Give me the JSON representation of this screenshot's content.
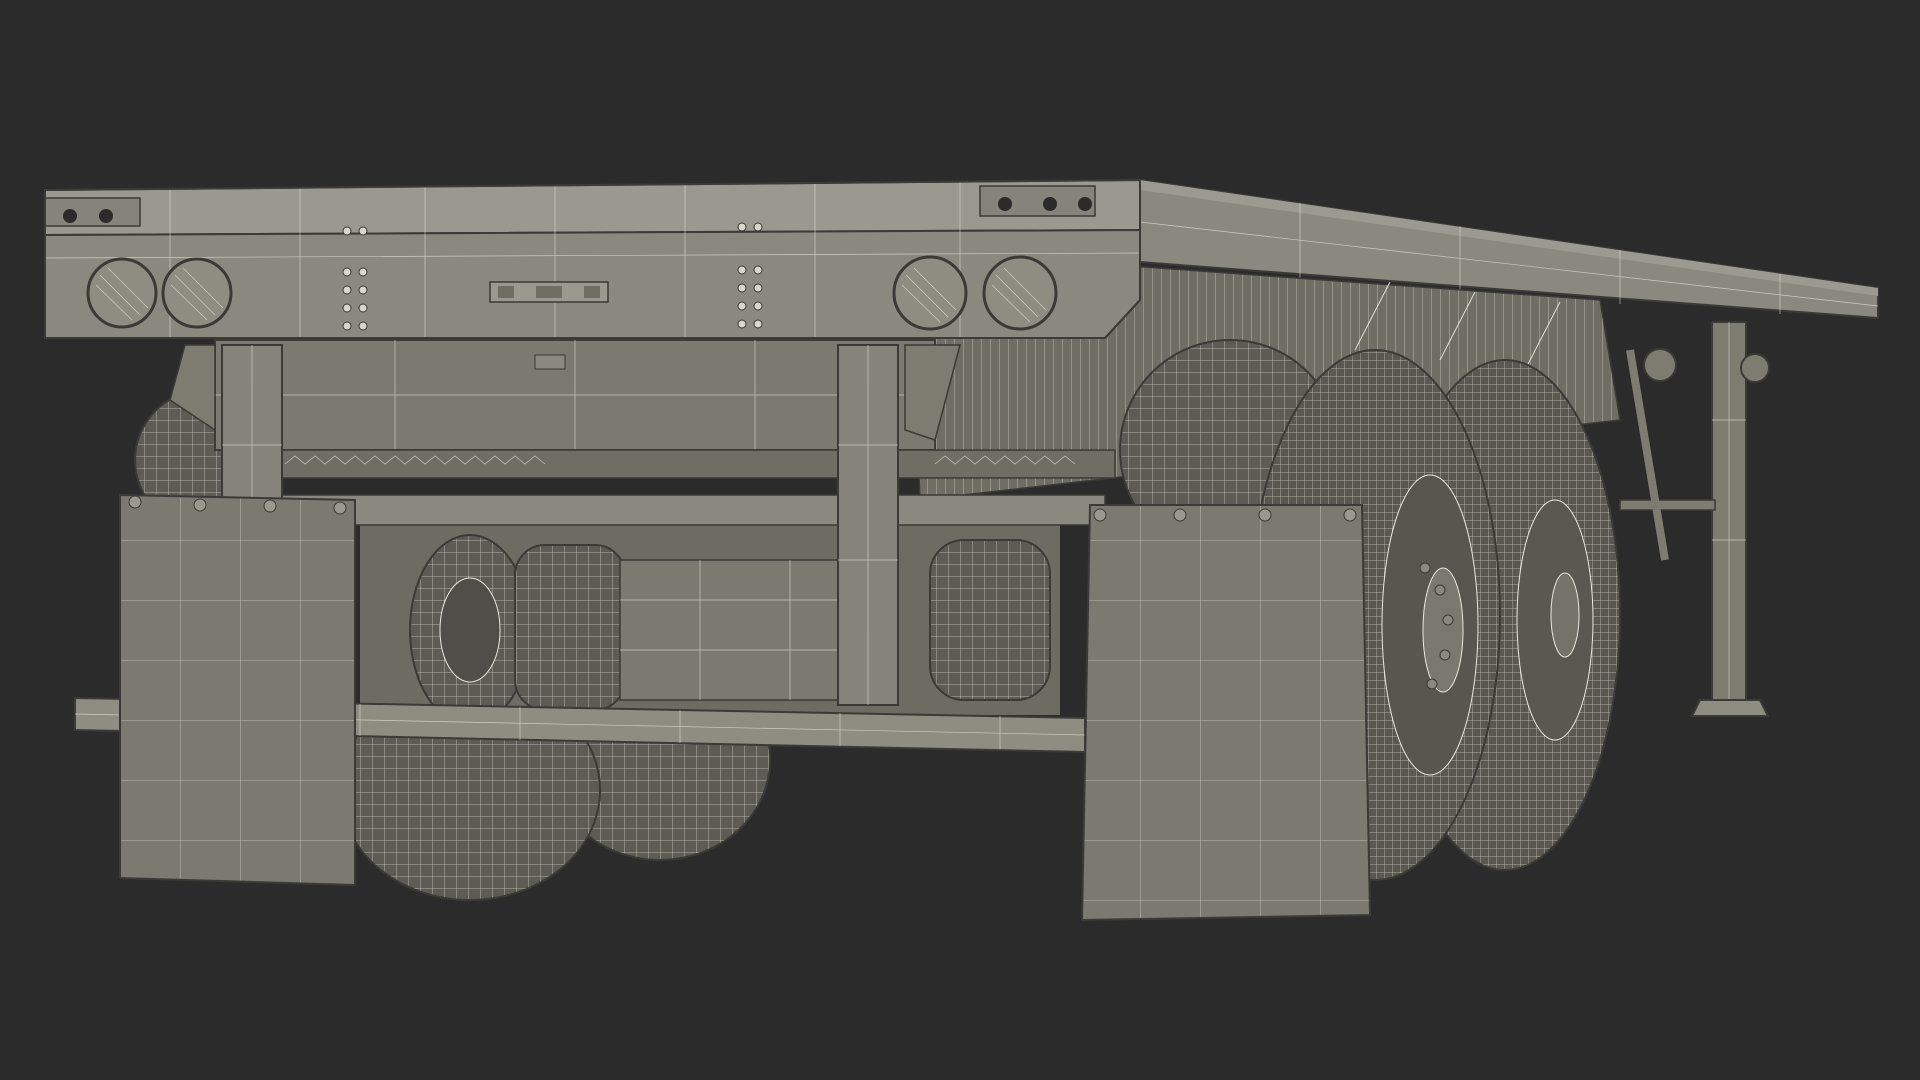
{
  "scene": {
    "subject": "flatbed-semi-trailer-wireframe",
    "colors": {
      "background": "#2b2b2b",
      "surface": "#7d7c71",
      "surface_light": "#8e8d82",
      "surface_dark": "#5f5e55",
      "tire": "#5a5a53",
      "wire": "#f2f2ea",
      "edge": "#3a3a36"
    }
  }
}
